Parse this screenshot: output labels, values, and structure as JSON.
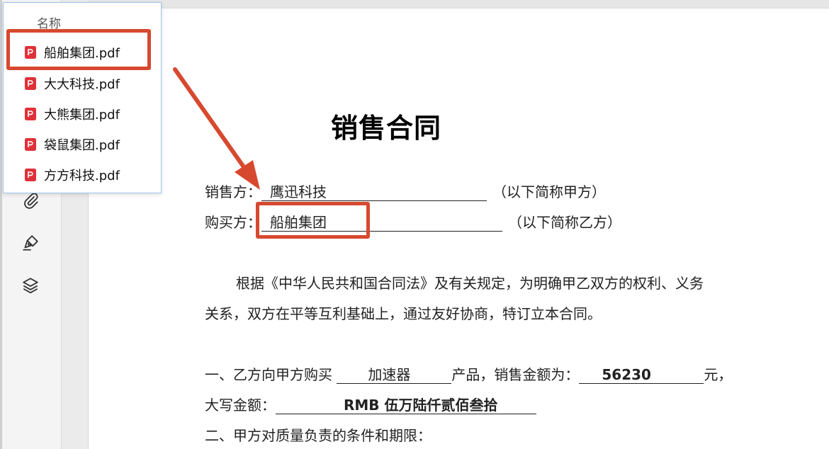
{
  "file_panel": {
    "header": "名称",
    "files": [
      {
        "name": "船舶集团.pdf",
        "icon": "pdf-file-icon"
      },
      {
        "name": "大大科技.pdf",
        "icon": "pdf-file-icon"
      },
      {
        "name": "大熊集团.pdf",
        "icon": "pdf-file-icon"
      },
      {
        "name": "袋鼠集团.pdf",
        "icon": "pdf-file-icon"
      },
      {
        "name": "方方科技.pdf",
        "icon": "pdf-file-icon"
      }
    ]
  },
  "sidebar": {
    "icons": [
      "attachment-icon",
      "signature-pen-icon",
      "layers-icon"
    ]
  },
  "document": {
    "title": "销售合同",
    "seller_label": "销售方：",
    "seller_value": "鹰迅科技",
    "seller_note": "（以下简称甲方）",
    "buyer_label": "购买方：",
    "buyer_value": "船舶集团",
    "buyer_note": "（以下简称乙方）",
    "para1_line1": "根据《中华人民共和国合同法》及有关规定，为明确甲乙双方的权利、义务",
    "para1_line2": "关系，双方在平等互利基础上，通过友好协商，特订立本合同。",
    "clause1_prefix": "一、乙方向甲方购买",
    "product_value": "加速器",
    "clause1_mid": "产品，销售金额为：",
    "amount_value": "56230",
    "clause1_suffix": "元，",
    "caps_label": "大写金额：",
    "caps_value": "RMB 伍万陆仟贰佰叁拾",
    "clause2": "二、甲方对质量负责的条件和期限："
  },
  "colors": {
    "highlight": "#d7492f",
    "pdf_icon": "#e0313a",
    "panel_border": "#9cc3ea"
  }
}
